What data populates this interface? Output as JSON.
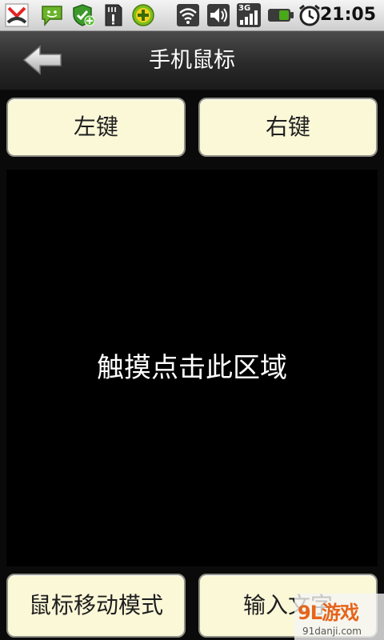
{
  "status_bar": {
    "time": "21:05",
    "network_label": "3G",
    "icons": [
      "missed-call-icon",
      "sms-icon",
      "shield-check-icon",
      "sd-card-icon",
      "add-icon",
      "wifi-icon",
      "volume-icon",
      "signal-icon",
      "battery-icon",
      "alarm-icon"
    ],
    "colors": {
      "missed_call": "#e52222",
      "sms": "#6ab42a",
      "shield": "#3d9a2a",
      "add": "#7bbf1f",
      "battery": "#4aa81a"
    }
  },
  "header": {
    "title": "手机鼠标",
    "back_icon": "back-arrow-icon"
  },
  "buttons": {
    "left_click": "左键",
    "right_click": "右键",
    "mouse_move_mode": "鼠标移动模式",
    "input_text": "输入文字"
  },
  "touch_area": {
    "label": "触摸点击此区域"
  },
  "watermark": {
    "logo": "9L游戏",
    "url": "91danji.com"
  },
  "colors": {
    "button_bg": "#fbf8d8",
    "button_border": "#8f8f86",
    "touch_bg": "#000000",
    "title_bar": "#2f2f2f"
  }
}
